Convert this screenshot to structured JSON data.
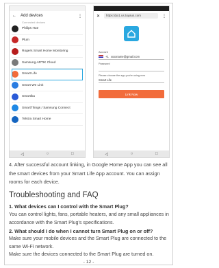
{
  "left_phone": {
    "title": "Add devices",
    "partial_top": "Connected devices",
    "devices": [
      {
        "name": "Philips Hue",
        "color": "#222222"
      },
      {
        "name": "Plum",
        "color": "#c62828"
      },
      {
        "name": "Rogers Smart Home Monitoring",
        "color": "#b71c1c"
      },
      {
        "name": "Samsung ARTIK Cloud",
        "color": "#7a7a7a"
      },
      {
        "name": "Smart Life",
        "color": "#f26c3b"
      },
      {
        "name": "Smart We Link",
        "color": "#2a7de1"
      },
      {
        "name": "Smartika",
        "color": "#2a5bd7"
      },
      {
        "name": "SmartThings / Samsung Connect",
        "color": "#1e88e5"
      },
      {
        "name": "Telstra Smart Home",
        "color": "#1565c0"
      }
    ],
    "highlighted_index": 4
  },
  "right_phone": {
    "url": "https://px1.us.tuyaus.com",
    "account_label": "Account",
    "country_code": "+1",
    "email": "xxxxname@gmail.com",
    "password_label": "Password",
    "platform_label": "Please choose the app you're using now",
    "platform_value": "Smart Life",
    "login_button": "Link Now"
  },
  "step4": "4. After successful account linking, in Google Home App you can see all the smart devices from your Smart Life App account. You can assign rooms for each device.",
  "faq": {
    "heading": "Troubleshooting and FAQ",
    "q1": "1. What devices can I control with the Smart Plug?",
    "a1": "You can control lights, fans, portable heaters, and any small appliances in accordance with the Smart Plug's specifications.",
    "q2": "2. What should I do when I cannot turn Smart Plug on or off?",
    "a2": "Make sure your mobile devices and the Smart Plug are connected to the same Wi-Fi network.",
    "a3": "Make sure the devices connected to the Smart Plug are turned on."
  },
  "page_number": "- 12 -"
}
